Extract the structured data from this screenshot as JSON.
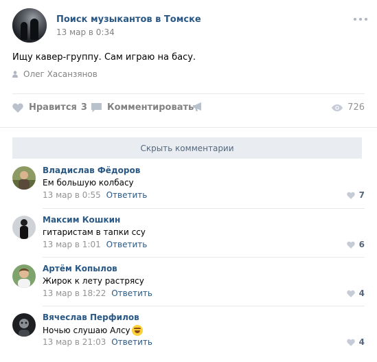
{
  "post": {
    "group_name": "Поиск музыкантов в Томске",
    "date": "13 мар в 0:34",
    "text": "Ищу кавер-группу. Сам играю на басу.",
    "author": "Олег Хасанзянов"
  },
  "actions": {
    "like_label": "Нравится",
    "like_count": "3",
    "comment_label": "Комментировать",
    "views": "726"
  },
  "comments_toggle": "Скрыть комментарии",
  "comments": [
    {
      "name": "Владислав Фёдоров",
      "text": "Ем большую колбасу",
      "date": "13 мар в 0:55",
      "reply": "Ответить",
      "likes": "7"
    },
    {
      "name": "Максим Кошкин",
      "text": "гитаристам в тапки ссу",
      "date": "13 мар в 1:01",
      "reply": "Ответить",
      "likes": "6"
    },
    {
      "name": "Артём Копылов",
      "text": "Жирок к лету растрясу",
      "date": "13 мар в 18:22",
      "reply": "Ответить",
      "likes": "4"
    },
    {
      "name": "Вячеслав Перфилов",
      "text": "Ночью слушаю Алсу",
      "date": "13 мар в 21:03",
      "reply": "Ответить",
      "likes": "4"
    }
  ],
  "colors": {
    "link": "#2a5885",
    "muted": "#828282",
    "bar": "#e9edf1"
  },
  "icons": [
    "more-icon",
    "user-icon",
    "heart-icon",
    "comment-icon",
    "megaphone-icon",
    "eye-icon",
    "laughing-emoji-icon"
  ]
}
